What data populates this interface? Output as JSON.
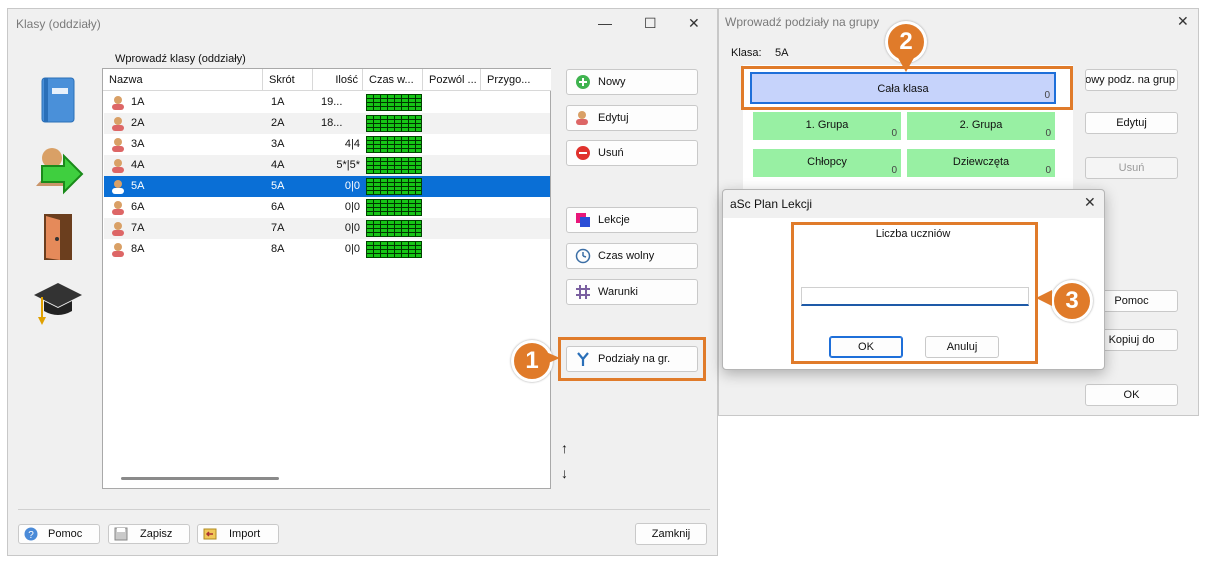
{
  "left_window": {
    "title": "Klasy (oddziały)",
    "grid_caption": "Wprowadź klasy (oddziały)",
    "columns": [
      "Nazwa",
      "Skrót",
      "Ilość",
      "Czas w...",
      "Pozwól ...",
      "Przygo..."
    ],
    "rows": [
      {
        "name": "1A",
        "short": "1A",
        "count": "19..."
      },
      {
        "name": "2A",
        "short": "2A",
        "count": "18..."
      },
      {
        "name": "3A",
        "short": "3A",
        "count": "4|4"
      },
      {
        "name": "4A",
        "short": "4A",
        "count": "5*|5*"
      },
      {
        "name": "5A",
        "short": "5A",
        "count": "0|0"
      },
      {
        "name": "6A",
        "short": "6A",
        "count": "0|0"
      },
      {
        "name": "7A",
        "short": "7A",
        "count": "0|0"
      },
      {
        "name": "8A",
        "short": "8A",
        "count": "0|0"
      }
    ],
    "selected_row": "5A",
    "buttons": {
      "new": "Nowy",
      "edit": "Edytuj",
      "delete": "Usuń",
      "lessons": "Lekcje",
      "free_time": "Czas wolny",
      "conditions": "Warunki",
      "group_divisions": "Podziały na gr."
    },
    "arrows": {
      "up": "↑",
      "down": "↓"
    },
    "footer": {
      "help": "Pomoc",
      "save": "Zapisz",
      "import": "Import",
      "close": "Zamknij"
    }
  },
  "right_window": {
    "title": "Wprowadź podziały na grupy",
    "class_label": "Klasa:",
    "class_value": "5A",
    "whole_class": {
      "label": "Cała klasa",
      "count": "0"
    },
    "groups": [
      {
        "label": "1. Grupa",
        "count": "0"
      },
      {
        "label": "2. Grupa",
        "count": "0"
      },
      {
        "label": "Chłopcy",
        "count": "0"
      },
      {
        "label": "Dziewczęta",
        "count": "0"
      }
    ],
    "buttons": {
      "new_division": "owy podz. na grup",
      "edit": "Edytuj",
      "delete": "Usuń",
      "help": "Pomoc",
      "copy_to": "Kopiuj do",
      "ok": "OK"
    }
  },
  "dialog": {
    "title": "aSc Plan Lekcji",
    "prompt": "Liczba uczniów",
    "input_value": "",
    "ok": "OK",
    "cancel": "Anuluj"
  },
  "callouts": [
    "1",
    "2",
    "3"
  ],
  "colors": {
    "accent_orange": "#e07b2a",
    "selection_blue": "#0a6fd6",
    "group_green": "#98f0a3",
    "whole_class_blue": "#c6d3fb"
  }
}
